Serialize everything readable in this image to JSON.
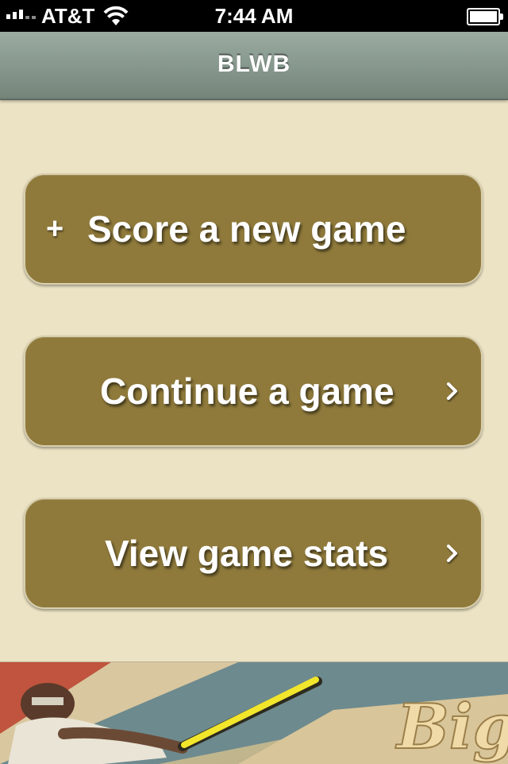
{
  "status_bar": {
    "carrier": "AT&T",
    "time": "7:44 AM",
    "signal_icon": "signal-bars-icon",
    "wifi_icon": "wifi-icon",
    "battery_icon": "battery-icon"
  },
  "nav": {
    "title": "BLWB"
  },
  "menu": {
    "new_game": {
      "label": "Score a new game",
      "icon": "plus-icon",
      "prefix": "+"
    },
    "continue_game": {
      "label": "Continue a game",
      "icon": "chevron-right-icon"
    },
    "view_stats": {
      "label": "View game stats",
      "icon": "chevron-right-icon"
    }
  },
  "banner": {
    "script_text": "Big",
    "image": "baseball-batter-illustration"
  },
  "colors": {
    "background": "#ece3c4",
    "button": "#8f7a3b",
    "nav_bar": "#85968c"
  }
}
